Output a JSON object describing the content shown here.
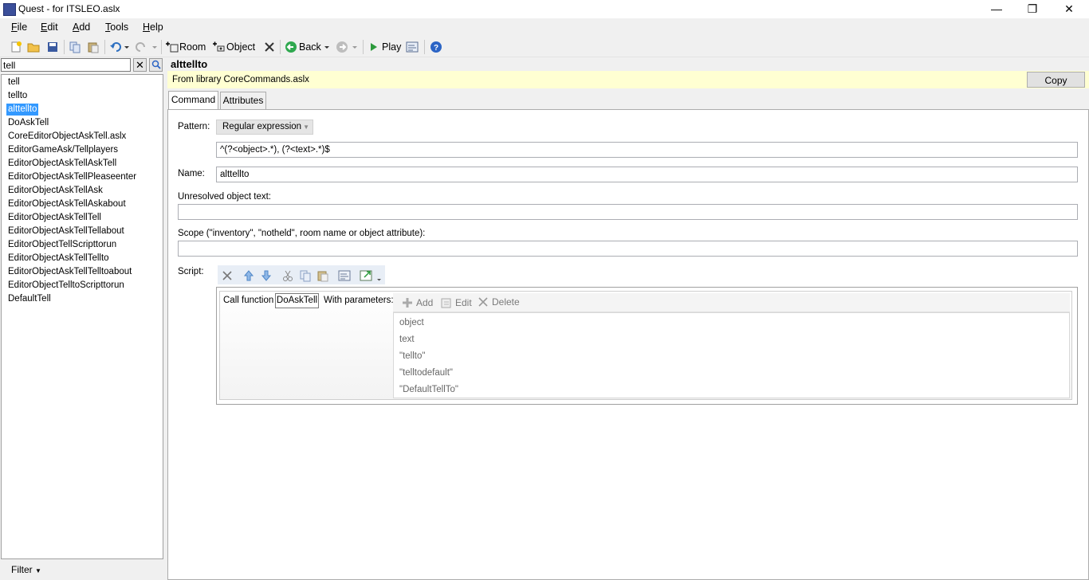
{
  "window": {
    "title": "Quest - for ITSLEO.aslx",
    "minimize_glyph": "—",
    "restore_glyph": "❐",
    "close_glyph": "✕"
  },
  "menu": [
    "File",
    "Edit",
    "Add",
    "Tools",
    "Help"
  ],
  "toolbar": {
    "room_label": "Room",
    "object_label": "Object",
    "back_label": "Back",
    "play_label": "Play"
  },
  "search": {
    "value": "tell"
  },
  "tree": {
    "items": [
      "tell",
      "tellto",
      "alttellto",
      "DoAskTell",
      "CoreEditorObjectAskTell.aslx",
      "EditorGameAsk/Tellplayers",
      "EditorObjectAskTellAskTell",
      "EditorObjectAskTellPleaseenter",
      "EditorObjectAskTellAsk",
      "EditorObjectAskTellAskabout",
      "EditorObjectAskTellTell",
      "EditorObjectAskTellTellabout",
      "EditorObjectTellScripttorun",
      "EditorObjectAskTellTellto",
      "EditorObjectAskTellTelltoabout",
      "EditorObjectTelltoScripttorun",
      "DefaultTell"
    ],
    "selected": "alttellto"
  },
  "filter_label": "Filter",
  "element": {
    "title": "alttellto",
    "library_text": "From library CoreCommands.aslx",
    "copy_label": "Copy"
  },
  "tabs": {
    "command": "Command",
    "attributes": "Attributes"
  },
  "form": {
    "pattern_label": "Pattern:",
    "pattern_type": "Regular expression",
    "pattern_value": "^(?<object>.*), (?<text>.*)$",
    "name_label": "Name:",
    "name_value": "alttellto",
    "unresolved_label": "Unresolved object text:",
    "unresolved_value": "",
    "scope_label": "Scope (\"inventory\", \"notheld\", room name or object attribute):",
    "scope_value": "",
    "script_label": "Script:"
  },
  "script": {
    "call_function_label": "Call function",
    "function_name": "DoAskTell",
    "with_parameters_label": "With parameters:",
    "add_label": "Add",
    "edit_label": "Edit",
    "delete_label": "Delete",
    "parameters": [
      "object",
      "text",
      "\"tellto\"",
      "\"telltodefault\"",
      "\"DefaultTellTo\""
    ]
  }
}
